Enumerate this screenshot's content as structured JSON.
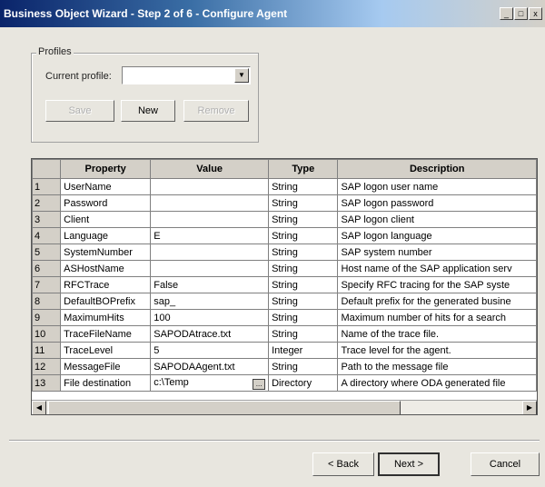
{
  "window": {
    "title": "Business Object Wizard - Step 2 of 6 - Configure Agent",
    "minimize_label": "_",
    "maximize_label": "□",
    "close_label": "x"
  },
  "profiles": {
    "group_label": "Profiles",
    "current_profile_label": "Current profile:",
    "current_profile_value": "",
    "save_label": "Save",
    "new_label": "New",
    "remove_label": "Remove"
  },
  "grid": {
    "headers": [
      "Property",
      "Value",
      "Type",
      "Description"
    ],
    "rows": [
      {
        "num": "1",
        "property": "UserName",
        "value": "",
        "type": "String",
        "description": "SAP logon user name"
      },
      {
        "num": "2",
        "property": "Password",
        "value": "",
        "type": "String",
        "description": "SAP logon password"
      },
      {
        "num": "3",
        "property": "Client",
        "value": "",
        "type": "String",
        "description": "SAP logon client"
      },
      {
        "num": "4",
        "property": "Language",
        "value": "E",
        "type": "String",
        "description": "SAP logon language"
      },
      {
        "num": "5",
        "property": "SystemNumber",
        "value": "",
        "type": "String",
        "description": "SAP system number"
      },
      {
        "num": "6",
        "property": "ASHostName",
        "value": "",
        "type": "String",
        "description": "Host name of the SAP application serv"
      },
      {
        "num": "7",
        "property": "RFCTrace",
        "value": "False",
        "type": "String",
        "description": "Specify RFC tracing for the SAP syste"
      },
      {
        "num": "8",
        "property": "DefaultBOPrefix",
        "value": "sap_",
        "type": "String",
        "description": "Default prefix for the generated busine"
      },
      {
        "num": "9",
        "property": "MaximumHits",
        "value": "100",
        "type": "String",
        "description": "Maximum number of hits for a search"
      },
      {
        "num": "10",
        "property": "TraceFileName",
        "value": "SAPODAtrace.txt",
        "type": "String",
        "description": "Name of the trace file."
      },
      {
        "num": "11",
        "property": "TraceLevel",
        "value": "5",
        "type": "Integer",
        "description": "Trace level for the agent."
      },
      {
        "num": "12",
        "property": "MessageFile",
        "value": "SAPODAAgent.txt",
        "type": "String",
        "description": "Path to the message file"
      },
      {
        "num": "13",
        "property": "File destination",
        "value": "c:\\Temp",
        "type": "Directory",
        "description": "A directory where ODA generated file"
      }
    ],
    "ellipsis_label": "..."
  },
  "footer": {
    "back_label": "< Back",
    "next_label": "Next >",
    "cancel_label": "Cancel"
  }
}
